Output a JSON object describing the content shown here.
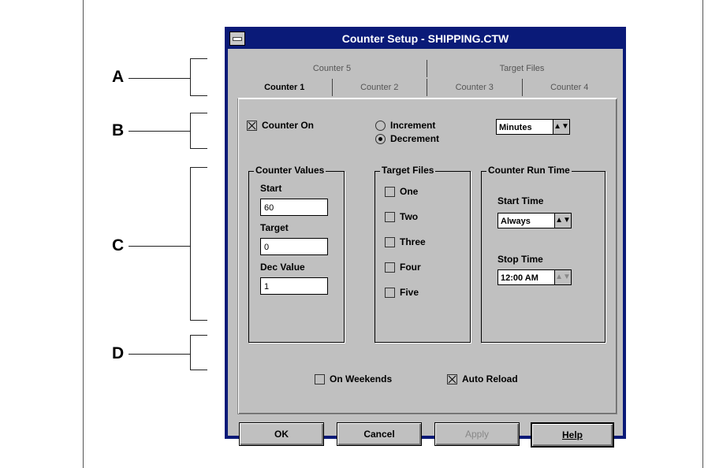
{
  "callouts": {
    "a": "A",
    "b": "B",
    "c": "C",
    "d": "D"
  },
  "window": {
    "title": "Counter Setup - SHIPPING.CTW"
  },
  "tabs": {
    "back_row": [
      "Counter 5",
      "Target Files"
    ],
    "front_row": [
      "Counter 1",
      "Counter 2",
      "Counter 3",
      "Counter 4"
    ],
    "active": "Counter 1"
  },
  "options": {
    "counter_on_label": "Counter On",
    "counter_on_checked": true,
    "increment_label": "Increment",
    "decrement_label": "Decrement",
    "selected_mode": "Decrement",
    "units_value": "Minutes"
  },
  "counter_values": {
    "title": "Counter Values",
    "start_label": "Start",
    "start_value": "60",
    "target_label": "Target",
    "target_value": "0",
    "dec_label": "Dec Value",
    "dec_value": "1"
  },
  "target_files": {
    "title": "Target Files",
    "items": [
      "One",
      "Two",
      "Three",
      "Four",
      "Five"
    ]
  },
  "run_time": {
    "title": "Counter Run Time",
    "start_label": "Start Time",
    "start_value": "Always",
    "stop_label": "Stop Time",
    "stop_value": "12:00 AM"
  },
  "flags": {
    "weekends_label": "On Weekends",
    "weekends_checked": false,
    "autoreload_label": "Auto Reload",
    "autoreload_checked": true
  },
  "buttons": {
    "ok": "OK",
    "cancel": "Cancel",
    "apply": "Apply",
    "help": "Help"
  },
  "icons": {
    "combo_arrow": "▲▼"
  }
}
